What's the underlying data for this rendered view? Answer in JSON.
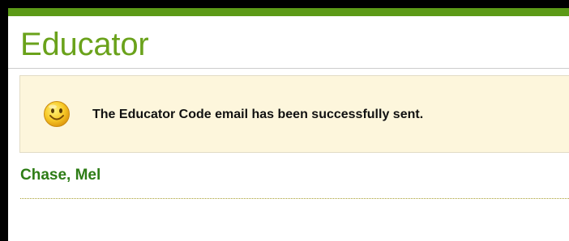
{
  "page": {
    "title": "Educator"
  },
  "alert": {
    "icon": "smiley-face-icon",
    "message": "The Educator Code email has been successfully sent."
  },
  "educator": {
    "name": "Chase, Mel"
  },
  "colors": {
    "top_bar": "#5c9a17",
    "title": "#6aa21b",
    "alert_background": "#fdf6dc",
    "name": "#2e7d16"
  }
}
